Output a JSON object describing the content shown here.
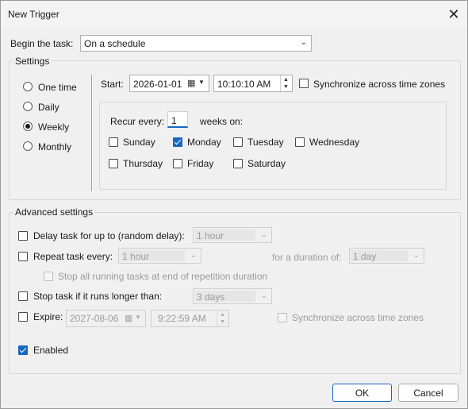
{
  "window": {
    "title": "New Trigger"
  },
  "begin_task": {
    "label": "Begin the task:",
    "value": "On a schedule"
  },
  "settings": {
    "title": "Settings",
    "schedule_options": [
      "One time",
      "Daily",
      "Weekly",
      "Monthly"
    ],
    "selected_option": "Weekly",
    "start_label": "Start:",
    "start_date": "2026-01-01",
    "start_time": "10:10:10 AM",
    "sync_label": "Synchronize across time zones",
    "recur_label": "Recur every:",
    "recur_value": "1",
    "weeks_on_label": "weeks on:",
    "days": {
      "sunday": "Sunday",
      "monday": "Monday",
      "tuesday": "Tuesday",
      "wednesday": "Wednesday",
      "thursday": "Thursday",
      "friday": "Friday",
      "saturday": "Saturday"
    },
    "checked_days": [
      "Monday"
    ]
  },
  "advanced": {
    "title": "Advanced settings",
    "delay_label": "Delay task for up to (random delay):",
    "delay_value": "1 hour",
    "repeat_label": "Repeat task every:",
    "repeat_value": "1 hour",
    "duration_label": "for a duration of:",
    "duration_value": "1 day",
    "stop_all_label": "Stop all running tasks at end of repetition duration",
    "stop_longer_label": "Stop task if it runs longer than:",
    "stop_longer_value": "3 days",
    "expire_label": "Expire:",
    "expire_date": "2027-08-06",
    "expire_time": "9:22:59 AM",
    "expire_sync_label": "Synchronize across time zones",
    "enabled_label": "Enabled",
    "enabled_checked": true
  },
  "buttons": {
    "ok": "OK",
    "cancel": "Cancel"
  },
  "icons": {
    "close": "close-icon",
    "calendar": "calendar-icon",
    "dropdown": "chevron-down-icon"
  },
  "colors": {
    "accent": "#1667c2",
    "background": "#f0f0f0"
  }
}
